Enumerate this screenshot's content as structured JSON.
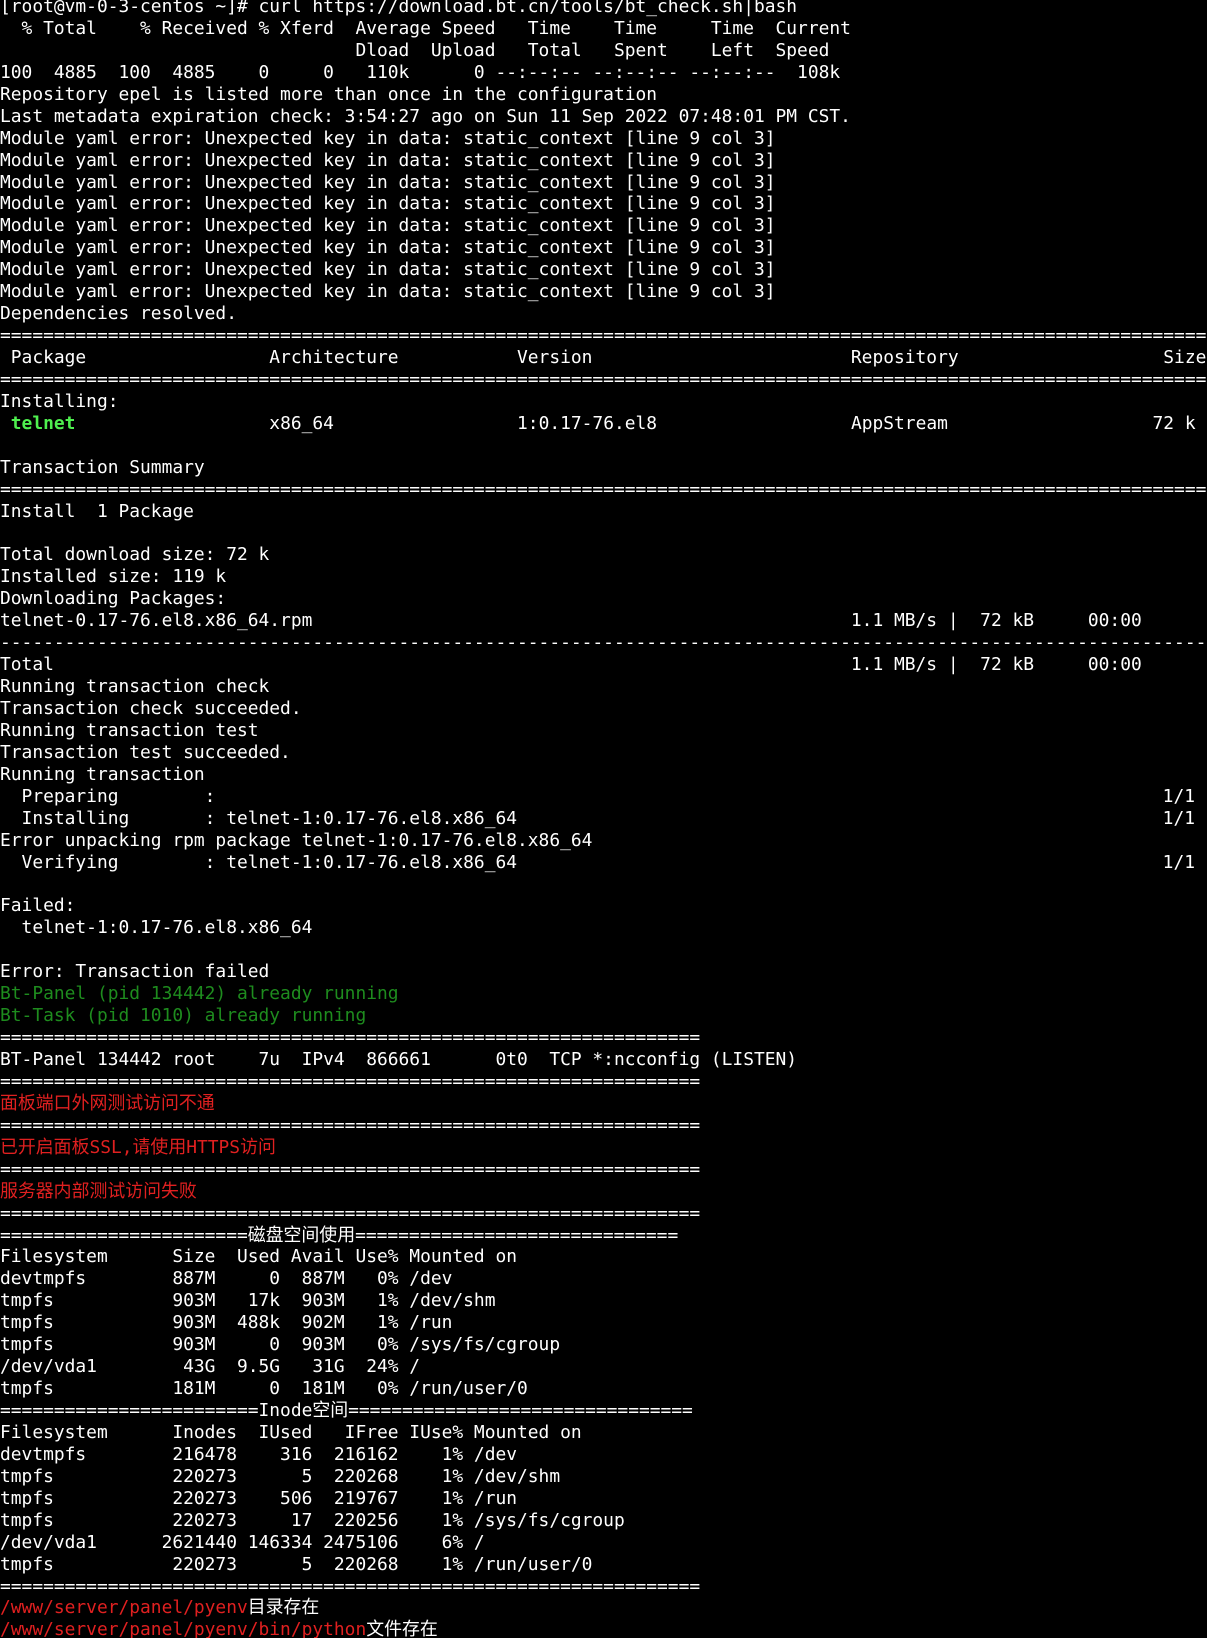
{
  "colors": {
    "background": "#000000",
    "text": "#ffffff",
    "green_bright": "#4ff04f",
    "green_dim": "#1e8c1e",
    "red": "#e02020",
    "red_dim": "#c82828"
  },
  "lines": [
    {
      "name": "curl-command-prompt",
      "text": "[root@vm-0-3-centos ~]# curl https://download.bt.cn/tools/bt_check.sh|bash"
    },
    {
      "name": "curl-progress-header-1",
      "text": "  % Total    % Received % Xferd  Average Speed   Time    Time     Time  Current"
    },
    {
      "name": "curl-progress-header-2",
      "text": "                                 Dload  Upload   Total   Spent    Left  Speed"
    },
    {
      "name": "curl-progress-values",
      "text": "100  4885  100  4885    0     0   110k      0 --:--:-- --:--:-- --:--:--  108k"
    },
    {
      "name": "repo-warning",
      "text": "Repository epel is listed more than once in the configuration"
    },
    {
      "name": "metadata-check",
      "text": "Last metadata expiration check: 3:54:27 ago on Sun 11 Sep 2022 07:48:01 PM CST."
    },
    {
      "name": "yaml-error",
      "text": "Module yaml error: Unexpected key in data: static_context [line 9 col 3]"
    },
    {
      "name": "yaml-error",
      "text": "Module yaml error: Unexpected key in data: static_context [line 9 col 3]"
    },
    {
      "name": "yaml-error",
      "text": "Module yaml error: Unexpected key in data: static_context [line 9 col 3]"
    },
    {
      "name": "yaml-error",
      "text": "Module yaml error: Unexpected key in data: static_context [line 9 col 3]"
    },
    {
      "name": "yaml-error",
      "text": "Module yaml error: Unexpected key in data: static_context [line 9 col 3]"
    },
    {
      "name": "yaml-error",
      "text": "Module yaml error: Unexpected key in data: static_context [line 9 col 3]"
    },
    {
      "name": "yaml-error",
      "text": "Module yaml error: Unexpected key in data: static_context [line 9 col 3]"
    },
    {
      "name": "yaml-error",
      "text": "Module yaml error: Unexpected key in data: static_context [line 9 col 3]"
    },
    {
      "name": "dependencies-resolved",
      "text": "Dependencies resolved."
    },
    {
      "name": "separator-line",
      "text": "================================================================================================================"
    },
    {
      "name": "package-table-header",
      "text": " Package                 Architecture           Version                        Repository                   Size"
    },
    {
      "name": "separator-line",
      "text": "================================================================================================================"
    },
    {
      "name": "installing-label",
      "text": "Installing:"
    },
    {
      "name": "package-row",
      "segments": [
        {
          "text": " ",
          "color": "#ffffff"
        },
        {
          "text": "telnet",
          "color": "#4ff04f",
          "bold": true
        },
        {
          "text": "                  x86_64                 1:0.17-76.el8                  AppStream                   72 k",
          "color": "#ffffff"
        }
      ]
    },
    {
      "name": "blank-line",
      "text": ""
    },
    {
      "name": "transaction-summary-label",
      "text": "Transaction Summary"
    },
    {
      "name": "separator-line",
      "text": "================================================================================================================"
    },
    {
      "name": "install-count",
      "text": "Install  1 Package"
    },
    {
      "name": "blank-line",
      "text": ""
    },
    {
      "name": "total-download-size",
      "text": "Total download size: 72 k"
    },
    {
      "name": "installed-size",
      "text": "Installed size: 119 k"
    },
    {
      "name": "downloading-packages",
      "text": "Downloading Packages:"
    },
    {
      "name": "download-row",
      "text": "telnet-0.17-76.el8.x86_64.rpm                                                  1.1 MB/s |  72 kB     00:00"
    },
    {
      "name": "dash-separator",
      "text": "----------------------------------------------------------------------------------------------------------------"
    },
    {
      "name": "download-total",
      "text": "Total                                                                          1.1 MB/s |  72 kB     00:00"
    },
    {
      "name": "transaction-step",
      "text": "Running transaction check"
    },
    {
      "name": "transaction-step",
      "text": "Transaction check succeeded."
    },
    {
      "name": "transaction-step",
      "text": "Running transaction test"
    },
    {
      "name": "transaction-step",
      "text": "Transaction test succeeded."
    },
    {
      "name": "transaction-step",
      "text": "Running transaction"
    },
    {
      "name": "progress-preparing",
      "text": "  Preparing        :",
      "right": "1/1"
    },
    {
      "name": "progress-installing",
      "text": "  Installing       : telnet-1:0.17-76.el8.x86_64",
      "right": "1/1"
    },
    {
      "name": "unpack-error",
      "text": "Error unpacking rpm package telnet-1:0.17-76.el8.x86_64"
    },
    {
      "name": "progress-verifying",
      "text": "  Verifying        : telnet-1:0.17-76.el8.x86_64",
      "right": "1/1"
    },
    {
      "name": "blank-line",
      "text": ""
    },
    {
      "name": "failed-label",
      "text": "Failed:"
    },
    {
      "name": "failed-package",
      "text": "  telnet-1:0.17-76.el8.x86_64"
    },
    {
      "name": "blank-line",
      "text": ""
    },
    {
      "name": "transaction-failed",
      "text": "Error: Transaction failed"
    },
    {
      "name": "bt-panel-running",
      "text": "Bt-Panel (pid 134442) already running",
      "color": "#1e8c1e"
    },
    {
      "name": "bt-task-running",
      "text": "Bt-Task (pid 1010) already running",
      "color": "#1e8c1e"
    },
    {
      "name": "separator-line",
      "text": "================================================================="
    },
    {
      "name": "port-listen-row",
      "text": "BT-Panel 134442 root    7u  IPv4  866661      0t0  TCP *:ncconfig (LISTEN)"
    },
    {
      "name": "separator-line",
      "text": "================================================================="
    },
    {
      "name": "panel-port-unreachable",
      "text": "面板端口外网测试访问不通",
      "color": "#e02020",
      "cjk": true
    },
    {
      "name": "separator-line",
      "text": "================================================================="
    },
    {
      "name": "ssl-enabled-notice",
      "text": "已开启面板SSL,请使用HTTPS访问",
      "color": "#e02020",
      "cjk": true
    },
    {
      "name": "separator-line",
      "text": "================================================================="
    },
    {
      "name": "internal-test-failed",
      "text": "服务器内部测试访问失败",
      "color": "#e02020",
      "cjk": true
    },
    {
      "name": "separator-line",
      "text": "================================================================="
    },
    {
      "name": "disk-usage-title",
      "text": "=======================磁盘空间使用==============================",
      "cjk": true
    },
    {
      "name": "df-header",
      "text": "Filesystem      Size  Used Avail Use% Mounted on"
    },
    {
      "name": "df-row",
      "text": "devtmpfs        887M     0  887M   0% /dev"
    },
    {
      "name": "df-row",
      "text": "tmpfs           903M   17k  903M   1% /dev/shm"
    },
    {
      "name": "df-row",
      "text": "tmpfs           903M  488k  902M   1% /run"
    },
    {
      "name": "df-row",
      "text": "tmpfs           903M     0  903M   0% /sys/fs/cgroup"
    },
    {
      "name": "df-row",
      "text": "/dev/vda1        43G  9.5G   31G  24% /"
    },
    {
      "name": "df-row",
      "text": "tmpfs           181M     0  181M   0% /run/user/0"
    },
    {
      "name": "inode-title",
      "text": "========================Inode空间================================",
      "cjk": true
    },
    {
      "name": "inode-header",
      "text": "Filesystem      Inodes  IUsed   IFree IUse% Mounted on"
    },
    {
      "name": "inode-row",
      "text": "devtmpfs        216478    316  216162    1% /dev"
    },
    {
      "name": "inode-row",
      "text": "tmpfs           220273      5  220268    1% /dev/shm"
    },
    {
      "name": "inode-row",
      "text": "tmpfs           220273    506  219767    1% /run"
    },
    {
      "name": "inode-row",
      "text": "tmpfs           220273     17  220256    1% /sys/fs/cgroup"
    },
    {
      "name": "inode-row",
      "text": "/dev/vda1      2621440 146334 2475106    6% /"
    },
    {
      "name": "inode-row",
      "text": "tmpfs           220273      5  220268    1% /run/user/0"
    },
    {
      "name": "separator-line",
      "text": "================================================================="
    },
    {
      "name": "pyenv-dir-exists",
      "cjk": true,
      "segments": [
        {
          "text": "/www/server/panel/pyenv",
          "color": "#e02020"
        },
        {
          "text": "目录存在",
          "color": "#ffffff"
        }
      ]
    },
    {
      "name": "pyenv-python-exists",
      "cjk": true,
      "segments": [
        {
          "text": "/www/server/panel/pyenv/bin/python",
          "color": "#e02020"
        },
        {
          "text": "文件存在",
          "color": "#ffffff"
        }
      ]
    }
  ],
  "cursor": {
    "color": "#1ec31e"
  }
}
